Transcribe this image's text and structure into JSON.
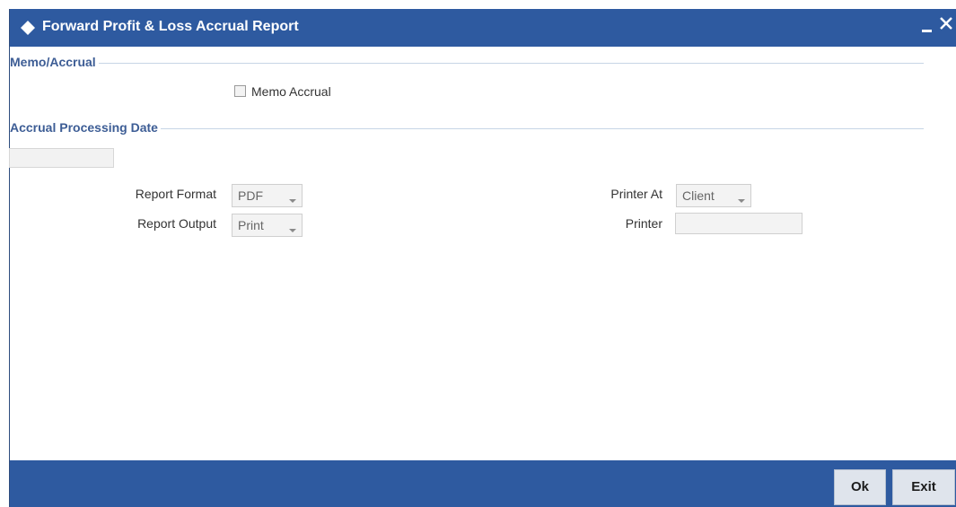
{
  "window": {
    "title": "Forward Profit & Loss Accrual Report"
  },
  "sections": {
    "memo_accrual": {
      "header": "Memo/Accrual",
      "checkbox_label": "Memo Accrual",
      "checked": false
    },
    "processing_date": {
      "header": "Accrual Processing Date",
      "date_value": ""
    }
  },
  "report": {
    "format_label": "Report Format",
    "format_value": "PDF",
    "output_label": "Report Output",
    "output_value": "Print",
    "printer_at_label": "Printer At",
    "printer_at_value": "Client",
    "printer_label": "Printer",
    "printer_value": ""
  },
  "buttons": {
    "ok": "Ok",
    "exit": "Exit"
  },
  "icons": {
    "title": "diamond-icon",
    "minimize": "minimize-icon",
    "close": "close-icon",
    "dropdown": "dropdown-arrow-icon"
  },
  "colors": {
    "titlebar": "#2e5aa0",
    "section_header_text": "#3d5d95",
    "footer": "#2e5aa0"
  }
}
